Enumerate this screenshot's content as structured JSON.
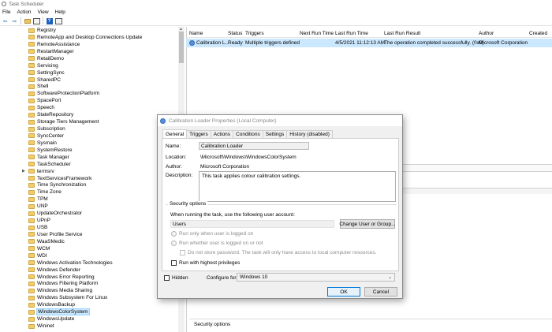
{
  "window": {
    "title": "Task Scheduler"
  },
  "menu": [
    "File",
    "Action",
    "View",
    "Help"
  ],
  "tree": {
    "items": [
      {
        "label": "Registry"
      },
      {
        "label": "RemoteApp and Desktop Connections Update"
      },
      {
        "label": "RemoteAssistance"
      },
      {
        "label": "RestartManager"
      },
      {
        "label": "RetailDemo"
      },
      {
        "label": "Servicing"
      },
      {
        "label": "SettingSync"
      },
      {
        "label": "SharedPC"
      },
      {
        "label": "Shell"
      },
      {
        "label": "SoftwareProtectionPlatform"
      },
      {
        "label": "SpacePort"
      },
      {
        "label": "Speech"
      },
      {
        "label": "StateRepository"
      },
      {
        "label": "Storage Tiers Management"
      },
      {
        "label": "Subscription"
      },
      {
        "label": "SyncCenter"
      },
      {
        "label": "Sysmain"
      },
      {
        "label": "SystemRestore"
      },
      {
        "label": "Task Manager"
      },
      {
        "label": "TaskScheduler"
      },
      {
        "label": "termsrv",
        "expandable": true
      },
      {
        "label": "TextServicesFramework"
      },
      {
        "label": "Time Synchronization"
      },
      {
        "label": "Time Zone"
      },
      {
        "label": "TPM"
      },
      {
        "label": "UNP"
      },
      {
        "label": "UpdateOrchestrator"
      },
      {
        "label": "UPnP"
      },
      {
        "label": "USB"
      },
      {
        "label": "User Profile Service"
      },
      {
        "label": "WaaSMedic"
      },
      {
        "label": "WCM"
      },
      {
        "label": "WDI"
      },
      {
        "label": "Windows Activation Technologies"
      },
      {
        "label": "Windows Defender"
      },
      {
        "label": "Windows Error Reporting"
      },
      {
        "label": "Windows Filtering Platform"
      },
      {
        "label": "Windows Media Sharing"
      },
      {
        "label": "Windows Subsystem For Linux"
      },
      {
        "label": "WindowsBackup"
      },
      {
        "label": "WindowsColorSystem",
        "selected": true
      },
      {
        "label": "WindowsUpdate"
      },
      {
        "label": "Wininet"
      }
    ]
  },
  "tasklist": {
    "headers": [
      "Name",
      "Status",
      "Triggers",
      "Next Run Time",
      "Last Run Time",
      "Last Run Result",
      "Author",
      "Created"
    ],
    "row": {
      "name": "Calibration L...",
      "status": "Ready",
      "triggers": "Multiple triggers defined",
      "next_run": "",
      "last_run": "4/5/2021 11:12:13 AM",
      "result": "The operation completed successfully. (0x0)",
      "author": "Microsoft Corporation",
      "created": ""
    }
  },
  "bottom": {
    "security_label": "Security options"
  },
  "dialog": {
    "title": "Calibration Loader Properties (Local Computer)",
    "tabs": [
      "General",
      "Triggers",
      "Actions",
      "Conditions",
      "Settings",
      "History (disabled)"
    ],
    "name_label": "Name:",
    "name_value": "Calibration Loader",
    "location_label": "Location:",
    "location_value": "\\Microsoft\\Windows\\WindowsColorSystem",
    "author_label": "Author:",
    "author_value": "Microsoft Corporation",
    "description_label": "Description:",
    "description_value": "This task applies colour calibration settings.",
    "security_title": "Security options",
    "account_prompt": "When running the task, use the following user account:",
    "account_value": "Users",
    "change_user_button": "Change User or Group...",
    "radio_logged_on": "Run only when user is logged on",
    "radio_whether": "Run whether user is logged on or not",
    "no_store_password": "Do not store password.  The task will only have access to local computer resources.",
    "highest_privileges": "Run with highest privileges",
    "hidden_label": "Hidden",
    "configure_label": "Configure for:",
    "configure_value": "Windows 10",
    "ok_button": "OK",
    "cancel_button": "Cancel"
  }
}
